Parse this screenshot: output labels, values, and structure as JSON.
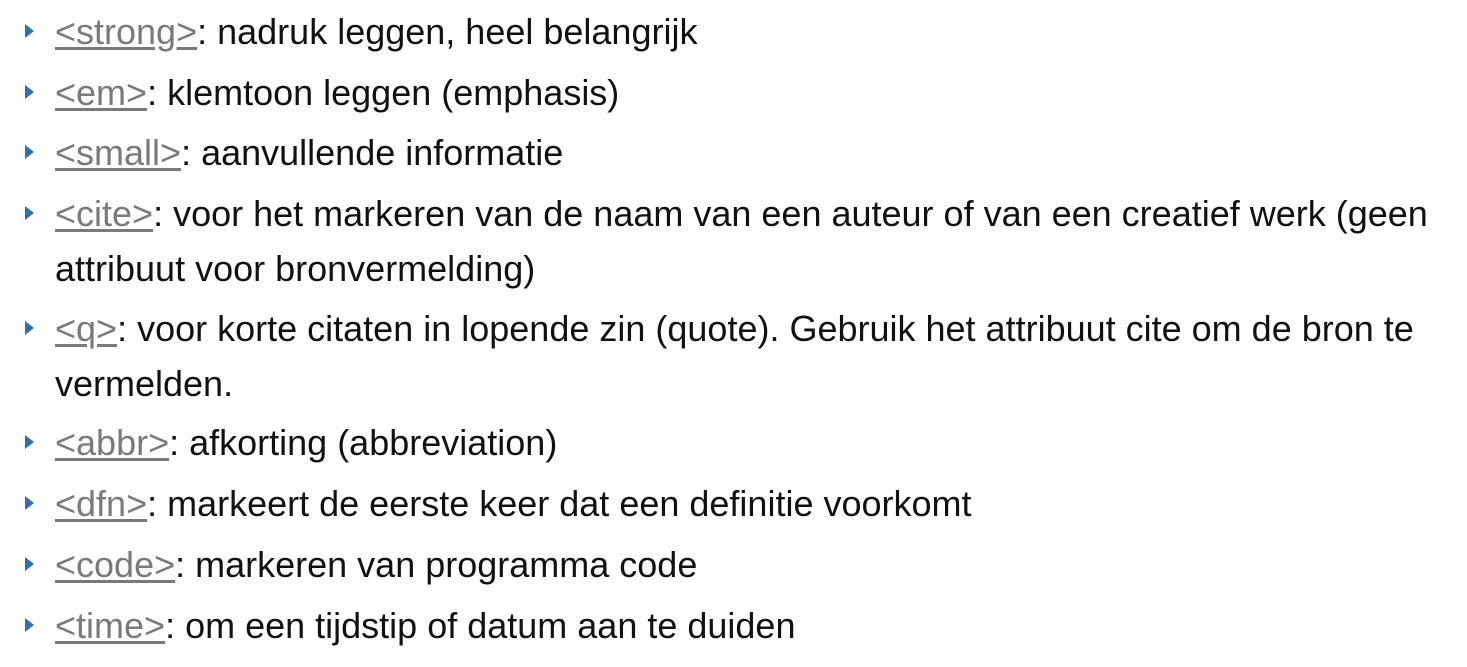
{
  "items": [
    {
      "tag": "<strong>",
      "text": ": nadruk leggen, heel belangrijk"
    },
    {
      "tag": "<em>",
      "text": ": klemtoon leggen (emphasis)"
    },
    {
      "tag": "<small>",
      "text": ": aanvullende informatie"
    },
    {
      "tag": "<cite>",
      "text": ": voor het markeren van de naam van een auteur of van een creatief werk (geen attribuut voor bronvermelding)"
    },
    {
      "tag": "<q>",
      "text": ": voor korte citaten in lopende zin (quote). Gebruik het attribuut cite om de bron te vermelden."
    },
    {
      "tag": "<abbr>",
      "text": ": afkorting (abbreviation)"
    },
    {
      "tag": "<dfn>",
      "text": ": markeert de eerste keer dat een definitie voorkomt"
    },
    {
      "tag": "<code>",
      "text": ": markeren van programma code"
    },
    {
      "tag": "<time>",
      "text": ": om een tijdstip of datum aan te duiden"
    }
  ],
  "colors": {
    "bullet": "#2e6fb0",
    "tag_link": "#7a7a7a",
    "text": "#111111"
  }
}
